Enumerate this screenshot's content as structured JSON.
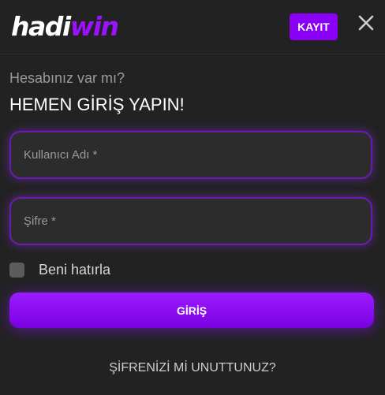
{
  "header": {
    "logo_white": "hadi",
    "logo_purple": "win",
    "register_label": "KAYIT",
    "close_icon": "close-icon"
  },
  "login": {
    "subtitle": "Hesabınız var mı?",
    "title": "HEMEN GİRİŞ YAPIN!",
    "username_placeholder": "Kullanıcı Adı *",
    "password_placeholder": "Şifre *",
    "remember_label": "Beni hatırla",
    "submit_label": "GİRİŞ",
    "forgot_label": "ŞİFRENİZİ Mİ UNUTTUNUZ?"
  },
  "colors": {
    "accent": "#8a00f5",
    "background": "#222222"
  }
}
